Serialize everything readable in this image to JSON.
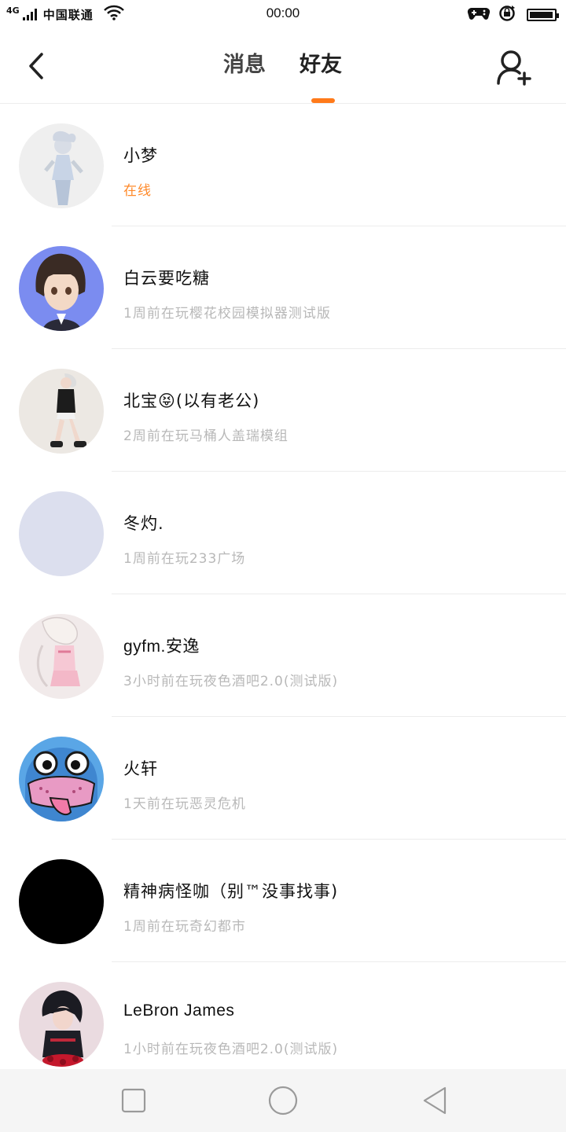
{
  "status_bar": {
    "network_type": "4G",
    "carrier": "中国联通",
    "time": "00:00",
    "battery_level": 0.95
  },
  "header": {
    "tabs": [
      {
        "label": "消息",
        "active": false
      },
      {
        "label": "好友",
        "active": true
      }
    ],
    "accent_color": "#ff7a1a",
    "back_icon": "chevron-left-icon",
    "add_friend_icon": "add-user-icon"
  },
  "friends": [
    {
      "name": "小梦",
      "status": "在线",
      "online": true
    },
    {
      "name": "白云要吃糖",
      "status": "1周前在玩樱花校园模拟器测试版",
      "online": false
    },
    {
      "name": "北宝😝(以有老公)",
      "status": "2周前在玩马桶人盖瑞模组",
      "online": false
    },
    {
      "name": "冬灼.",
      "status": "1周前在玩233广场",
      "online": false
    },
    {
      "name": "gyfm.安逸",
      "status": "3小时前在玩夜色酒吧2.0(测试版)",
      "online": false
    },
    {
      "name": "火轩",
      "status": "1天前在玩恶灵危机",
      "online": false
    },
    {
      "name": "精神病怪咖（别™没事找事)",
      "status": "1周前在玩奇幻都市",
      "online": false
    },
    {
      "name": "LeBron James",
      "status": "1小时前在玩夜色酒吧2.0(测试版)",
      "online": false
    }
  ],
  "system_nav": {
    "recent_icon": "square-icon",
    "home_icon": "circle-icon",
    "back_icon": "triangle-back-icon"
  }
}
